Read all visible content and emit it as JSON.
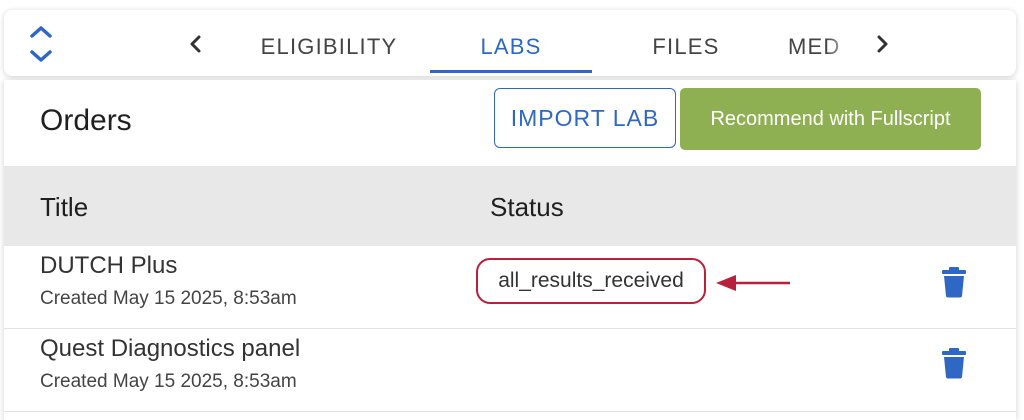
{
  "tabs": [
    {
      "label": "ELIGIBILITY",
      "active": false
    },
    {
      "label": "LABS",
      "active": true
    },
    {
      "label": "FILES",
      "active": false
    },
    {
      "label": "MED",
      "active": false
    }
  ],
  "orders": {
    "title": "Orders",
    "import_label": "IMPORT LAB",
    "recommend_label": "Recommend with Fullscript",
    "columns": {
      "title": "Title",
      "status": "Status"
    },
    "rows": [
      {
        "title": "DUTCH Plus",
        "created": "Created May 15 2025, 8:53am",
        "status": ""
      },
      {
        "title": "Quest Diagnostics panel",
        "created": "Created May 15 2025, 8:53am",
        "status": "all_results_received"
      }
    ]
  },
  "colors": {
    "accent": "#2f68c4",
    "fullscript_green": "#8eb053",
    "annotation_red": "#b8203b",
    "header_bg": "#e8e8e8"
  },
  "icons": [
    "unfold-icon",
    "chevron-left-icon",
    "chevron-right-icon",
    "trash-icon",
    "arrow-left-icon"
  ]
}
